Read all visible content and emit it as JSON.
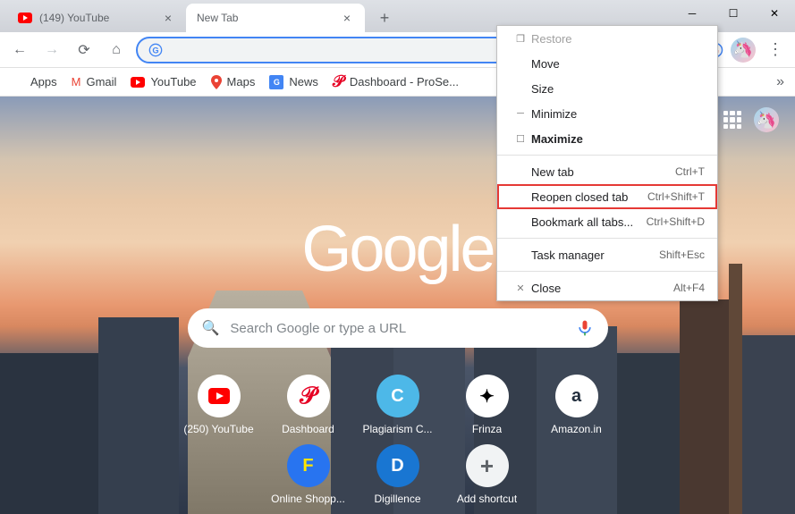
{
  "tabs": [
    {
      "title": "(149) YouTube",
      "active": false,
      "icon": "youtube"
    },
    {
      "title": "New Tab",
      "active": true,
      "icon": ""
    }
  ],
  "bookmarks": [
    {
      "label": "Apps",
      "icon": "apps"
    },
    {
      "label": "Gmail",
      "icon": "gmail"
    },
    {
      "label": "YouTube",
      "icon": "youtube"
    },
    {
      "label": "Maps",
      "icon": "maps"
    },
    {
      "label": "News",
      "icon": "news"
    },
    {
      "label": "Dashboard - ProSe...",
      "icon": "pinterest"
    }
  ],
  "logo_text": "Google",
  "search_placeholder": "Search Google or type a URL",
  "shortcuts_row1": [
    {
      "label": "(250) YouTube",
      "icon": "youtube"
    },
    {
      "label": "Dashboard",
      "icon": "pinterest"
    },
    {
      "label": "Plagiarism C...",
      "icon": "copyscape"
    },
    {
      "label": "Frinza",
      "icon": "frinza"
    }
  ],
  "shortcuts_row2": [
    {
      "label": "Amazon.in",
      "icon": "amazon"
    },
    {
      "label": "Online Shopp...",
      "icon": "flipkart"
    },
    {
      "label": "Digillence",
      "icon": "digillence"
    },
    {
      "label": "Add shortcut",
      "icon": "add"
    }
  ],
  "context_menu": [
    {
      "label": "Restore",
      "shortcut": "",
      "disabled": true,
      "icon": "restore",
      "bold": false
    },
    {
      "label": "Move",
      "shortcut": "",
      "disabled": false,
      "icon": "",
      "bold": false
    },
    {
      "label": "Size",
      "shortcut": "",
      "disabled": false,
      "icon": "",
      "bold": false
    },
    {
      "label": "Minimize",
      "shortcut": "",
      "disabled": false,
      "icon": "min",
      "bold": false
    },
    {
      "label": "Maximize",
      "shortcut": "",
      "disabled": false,
      "icon": "max",
      "bold": true
    },
    {
      "sep": true
    },
    {
      "label": "New tab",
      "shortcut": "Ctrl+T",
      "disabled": false,
      "icon": "",
      "bold": false
    },
    {
      "label": "Reopen closed tab",
      "shortcut": "Ctrl+Shift+T",
      "disabled": false,
      "icon": "",
      "bold": false,
      "highlighted": true
    },
    {
      "label": "Bookmark all tabs...",
      "shortcut": "Ctrl+Shift+D",
      "disabled": false,
      "icon": "",
      "bold": false
    },
    {
      "sep": true
    },
    {
      "label": "Task manager",
      "shortcut": "Shift+Esc",
      "disabled": false,
      "icon": "",
      "bold": false
    },
    {
      "sep": true
    },
    {
      "label": "Close",
      "shortcut": "Alt+F4",
      "disabled": false,
      "icon": "close",
      "bold": false
    }
  ]
}
